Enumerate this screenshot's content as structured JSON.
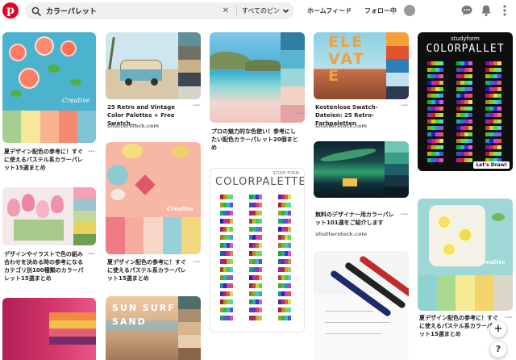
{
  "header": {
    "search_query": "カラーパレット",
    "scope_label": "すべてのピン",
    "nav_home": "ホームフィード",
    "nav_following": "フォロー中"
  },
  "pins": {
    "p1": {
      "caption": "夏デザイン配色の参考に！すぐに使えるパステル系カラーパレット15選まとめ",
      "watermark": "Creative"
    },
    "p2": {
      "caption": "25 Retro and Vintage Color Palettes + Free Swatch…",
      "source": "shutterstock.com"
    },
    "p3": {
      "caption": "プロの魅力的な色使い！参考にしたい配色カラーパレット20個まとめ"
    },
    "p4": {
      "caption": "Kostenlose Swatch-Dateien: 25 Retro-Farbpaletten",
      "source": "shutterstock.com",
      "art_text": "ELEVATE"
    },
    "p5": {
      "brand": "studyform",
      "title": "COLORPALLET",
      "footer": "Let's Draw!"
    },
    "p6": {
      "caption": "デザインやイラストで色の組み合わせを決める時の参考になるカテゴリ別100種類のカラーパレット15選まとめ"
    },
    "p7": {
      "caption": "夏デザイン配色の参考に！すぐに使えるパステル系カラーパレット15選まとめ",
      "watermark": "Creative"
    },
    "p8": {
      "brand": "STUDY FORM",
      "title": "COLORPALETTE"
    },
    "p9": {
      "caption": "無料のデザイナー用カラーパレット101選をご紹介します",
      "source": "shutterstock.com"
    },
    "p10": {
      "caption": "夏デザイン配色の参考に！すぐに使えるパステル系カラーパレット15選まとめ",
      "watermark": "Creative"
    },
    "p11": {
      "art_text": "SUN SURF SAND"
    }
  },
  "more_label": "···",
  "help_label": "?",
  "add_label": "+",
  "colors": {
    "brand": "#e60023",
    "search_bg": "#efefef",
    "text": "#222222"
  },
  "icons": [
    "pinterest-logo-icon",
    "search-icon",
    "close-icon",
    "chevron-down-icon",
    "messages-icon",
    "notifications-icon",
    "more-options-icon"
  ]
}
